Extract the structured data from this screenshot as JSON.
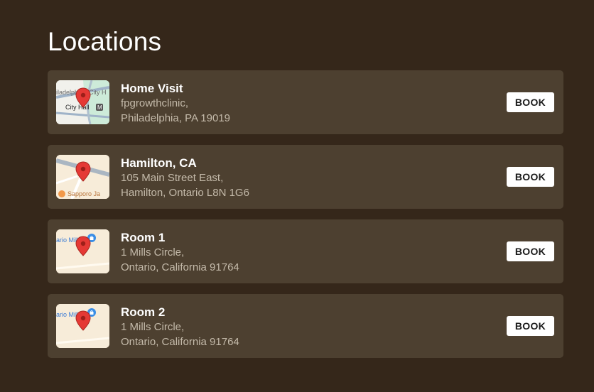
{
  "page": {
    "title": "Locations"
  },
  "colors": {
    "background": "#35271a",
    "card": "#4d4030",
    "pin": "#e53935",
    "book_button": "#ffffff"
  },
  "locations": [
    {
      "name": "Home Visit",
      "address_line1": "fpgrowthclinic,",
      "address_line2": "Philadelphia, PA 19019",
      "book_label": "BOOK",
      "map_labels": [
        "iladelphia",
        "City H",
        "City Hall",
        "M"
      ]
    },
    {
      "name": "Hamilton, CA",
      "address_line1": "105 Main Street East,",
      "address_line2": "Hamilton, Ontario L8N 1G6",
      "book_label": "BOOK",
      "map_labels": [
        "Sapporo Ja"
      ]
    },
    {
      "name": "Room 1",
      "address_line1": "1 Mills Circle,",
      "address_line2": "Ontario, California 91764",
      "book_label": "BOOK",
      "map_labels": [
        "ario Mills"
      ]
    },
    {
      "name": "Room 2",
      "address_line1": "1 Mills Circle,",
      "address_line2": "Ontario, California 91764",
      "book_label": "BOOK",
      "map_labels": [
        "ario Mills"
      ]
    }
  ]
}
